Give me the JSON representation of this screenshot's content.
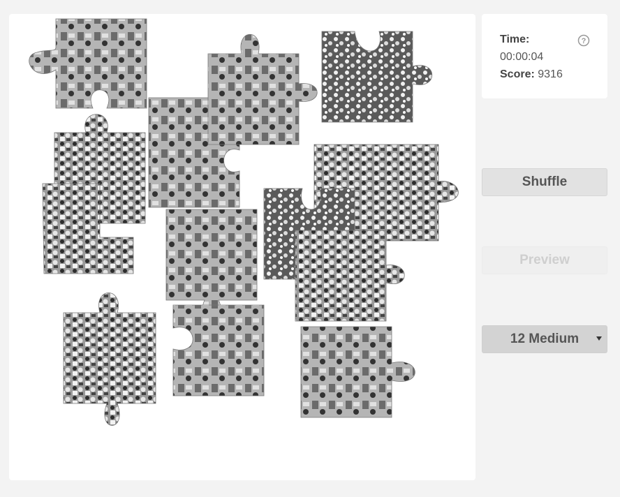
{
  "colors": {
    "background": "#f3f3f3",
    "board": "#ffffff",
    "button": "#e2e2e2"
  },
  "stats": {
    "time_label": "Time:",
    "time_value": "00:00:04",
    "score_label": "Score:",
    "score_value": "9316",
    "help_icon": "question-circle-icon"
  },
  "controls": {
    "shuffle_label": "Shuffle",
    "preview_label": "Preview",
    "difficulty_label": "12 Medium"
  },
  "puzzle": {
    "piece_count": 12,
    "placed_pieces": 0
  }
}
